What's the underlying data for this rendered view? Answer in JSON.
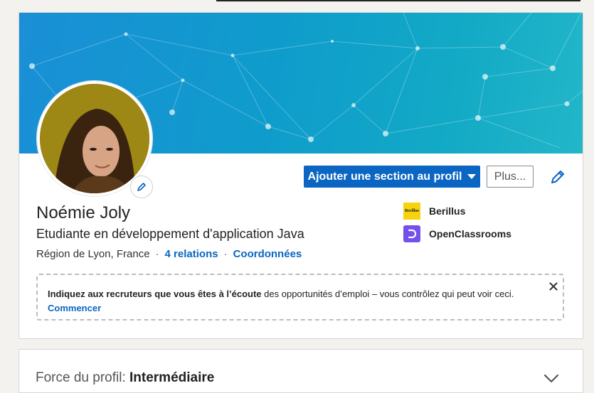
{
  "profile": {
    "name": "Noémie Joly",
    "headline": "Etudiante en développement d'application Java",
    "location": "Région de Lyon, France",
    "relations": "4 relations",
    "contact": "Coordonnées"
  },
  "actions": {
    "add_section": "Ajouter une section au profil",
    "more": "Plus..."
  },
  "companies": [
    {
      "name": "Berillus",
      "logo_text": "Berillus"
    },
    {
      "name": "OpenClassrooms"
    }
  ],
  "notice": {
    "bold": "Indiquez aux recruteurs que vous êtes à l’écoute",
    "rest": " des opportunités d’emploi – vous contrôlez qui peut voir ceci.",
    "cta": "Commencer"
  },
  "strength": {
    "label": "Force du profil: ",
    "value": "Intermédiaire"
  },
  "colors": {
    "accent": "#0a66c2",
    "banner": "#12a9c6",
    "berillus": "#f6d20f",
    "openclassrooms": "#7451eb"
  },
  "icons": {
    "edit": "pencil-icon",
    "close": "close-icon",
    "dropdown": "caret-down-icon",
    "expand": "chevron-down-icon"
  }
}
